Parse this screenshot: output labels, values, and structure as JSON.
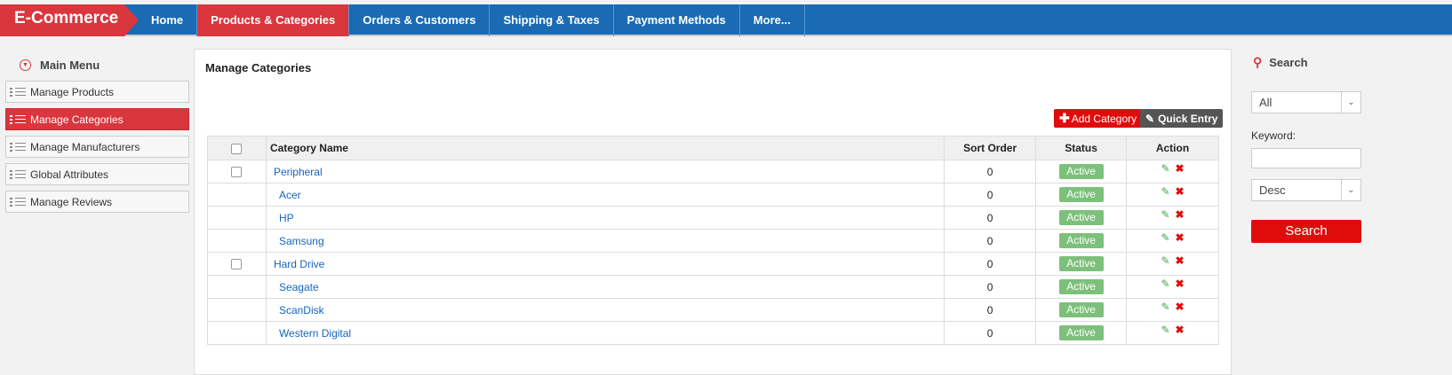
{
  "brand": "E-Commerce",
  "nav": {
    "items": [
      {
        "label": "Home"
      },
      {
        "label": "Products & Categories"
      },
      {
        "label": "Orders & Customers"
      },
      {
        "label": "Shipping & Taxes"
      },
      {
        "label": "Payment Methods"
      },
      {
        "label": "More..."
      }
    ],
    "active": "Products & Categories"
  },
  "sidebar": {
    "title": "Main Menu",
    "items": [
      {
        "label": "Manage Products"
      },
      {
        "label": "Manage Categories"
      },
      {
        "label": "Manage Manufacturers"
      },
      {
        "label": "Global Attributes"
      },
      {
        "label": "Manage Reviews"
      }
    ],
    "active": "Manage Categories"
  },
  "main": {
    "title": "Manage Categories",
    "add_label": "Add Category",
    "quick_label": "Quick Entry",
    "table": {
      "headers": {
        "name": "Category Name",
        "sort": "Sort Order",
        "status": "Status",
        "action": "Action"
      },
      "rows": [
        {
          "name": "Peripheral",
          "sort": "0",
          "status": "Active"
        },
        {
          "name": "Acer",
          "sort": "0",
          "status": "Active"
        },
        {
          "name": "HP",
          "sort": "0",
          "status": "Active"
        },
        {
          "name": "Samsung",
          "sort": "0",
          "status": "Active"
        },
        {
          "name": "Hard Drive",
          "sort": "0",
          "status": "Active"
        },
        {
          "name": "Seagate",
          "sort": "0",
          "status": "Active"
        },
        {
          "name": "ScanDisk",
          "sort": "0",
          "status": "Active"
        },
        {
          "name": "Western Digital",
          "sort": "0",
          "status": "Active"
        }
      ]
    }
  },
  "search": {
    "title": "Search",
    "filter_value": "All",
    "keyword_label": "Keyword:",
    "keyword_value": "",
    "order_value": "Desc",
    "button_label": "Search"
  },
  "colors": {
    "brand_red": "#d9363e",
    "nav_blue": "#1a6bb3",
    "status_green": "#7dc07b"
  }
}
